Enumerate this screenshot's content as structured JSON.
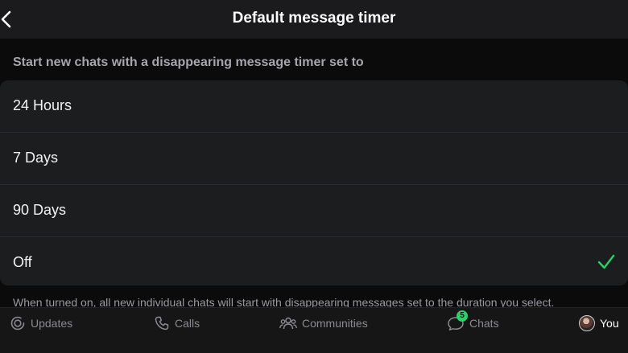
{
  "header": {
    "title": "Default message timer",
    "back_icon": "chevron-left-icon"
  },
  "section_label": "Start new chats with a disappearing message timer set to",
  "options": [
    {
      "label": "24 Hours",
      "selected": false
    },
    {
      "label": "7 Days",
      "selected": false
    },
    {
      "label": "90 Days",
      "selected": false
    },
    {
      "label": "Off",
      "selected": true
    }
  ],
  "footnote": "When turned on, all new individual chats will start with disappearing messages set to the duration you select.",
  "tabbar": {
    "tabs": [
      {
        "label": "Updates",
        "icon": "updates-icon",
        "active": false
      },
      {
        "label": "Calls",
        "icon": "phone-icon",
        "active": false
      },
      {
        "label": "Communities",
        "icon": "people-icon",
        "active": false
      },
      {
        "label": "Chats",
        "icon": "chat-bubble-icon",
        "active": false,
        "badge": "5"
      },
      {
        "label": "You",
        "icon": "avatar",
        "active": true
      }
    ]
  },
  "colors": {
    "accent": "#25d366",
    "background": "#0b0b0c",
    "surface": "#1c1d1f"
  }
}
